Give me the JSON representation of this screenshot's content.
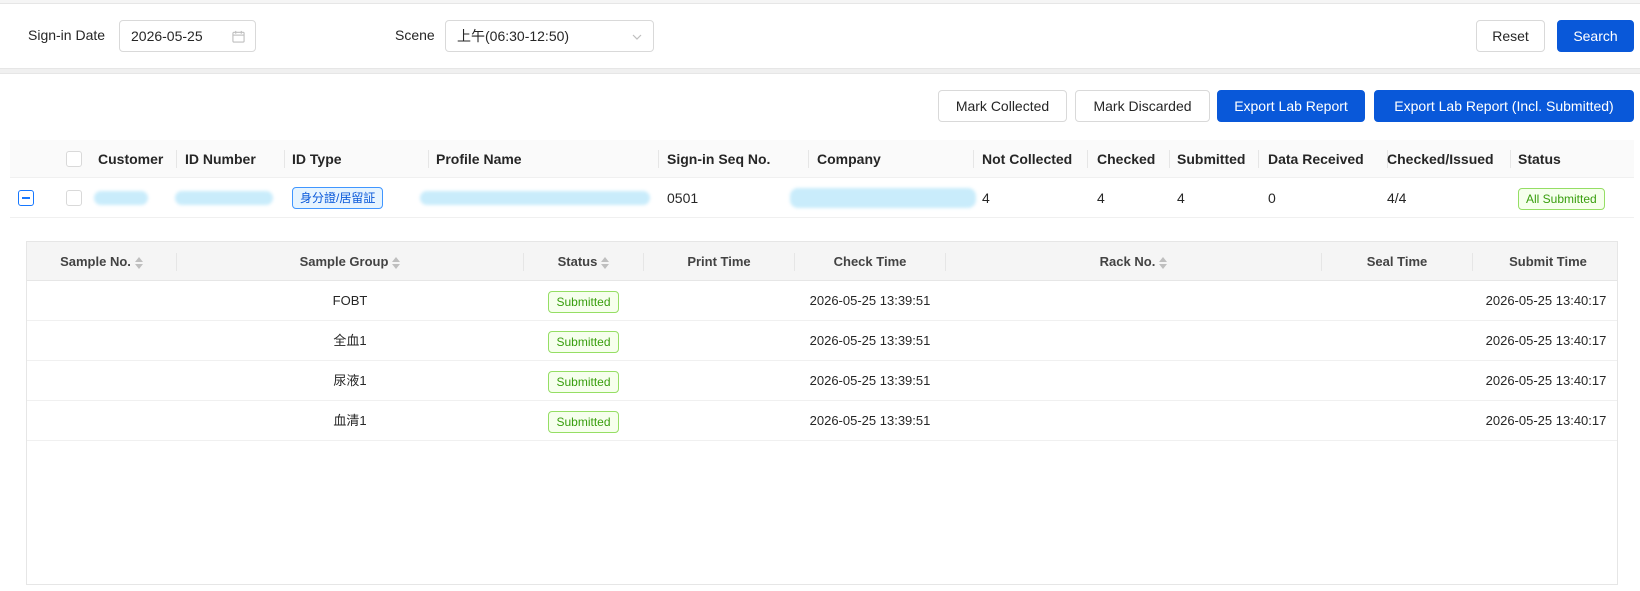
{
  "filters": {
    "sign_in_date_label": "Sign-in Date",
    "sign_in_date_value": "2026-05-25",
    "scene_label": "Scene",
    "scene_value": "上午(06:30-12:50)",
    "reset_label": "Reset",
    "search_label": "Search"
  },
  "toolbar": {
    "mark_collected": "Mark Collected",
    "mark_discarded": "Mark Discarded",
    "export_lab_report": "Export Lab Report",
    "export_lab_report_incl": "Export Lab Report (Incl. Submitted)"
  },
  "main_table": {
    "columns": [
      "Customer",
      "ID Number",
      "ID Type",
      "Profile Name",
      "Sign-in Seq No.",
      "Company",
      "Not Collected",
      "Checked",
      "Submitted",
      "Data Received",
      "Checked/Issued",
      "Status"
    ],
    "row": {
      "id_type": "身分證/居留証",
      "seq_no": "0501",
      "not_collected": "4",
      "checked": "4",
      "submitted": "4",
      "data_received": "0",
      "checked_issued": "4/4",
      "status": "All Submitted"
    }
  },
  "sub_table": {
    "columns": [
      "Sample No.",
      "Sample Group",
      "Status",
      "Print Time",
      "Check Time",
      "Rack No.",
      "Seal Time",
      "Submit Time"
    ],
    "rows": [
      {
        "group": "FOBT",
        "status": "Submitted",
        "check_time": "2026-05-25 13:39:51",
        "submit_time": "2026-05-25 13:40:17"
      },
      {
        "group": "全血1",
        "status": "Submitted",
        "check_time": "2026-05-25 13:39:51",
        "submit_time": "2026-05-25 13:40:17"
      },
      {
        "group": "尿液1",
        "status": "Submitted",
        "check_time": "2026-05-25 13:39:51",
        "submit_time": "2026-05-25 13:40:17"
      },
      {
        "group": "血清1",
        "status": "Submitted",
        "check_time": "2026-05-25 13:39:51",
        "submit_time": "2026-05-25 13:40:17"
      }
    ]
  },
  "icons": {
    "calendar": "calendar-icon",
    "dropdown": "chevron-down-icon",
    "sort": "sort-icon",
    "expand": "collapse-row-icon"
  },
  "colors": {
    "primary": "#0958d9",
    "success_text": "#389e0d",
    "id_tag_text": "#0958d9"
  }
}
